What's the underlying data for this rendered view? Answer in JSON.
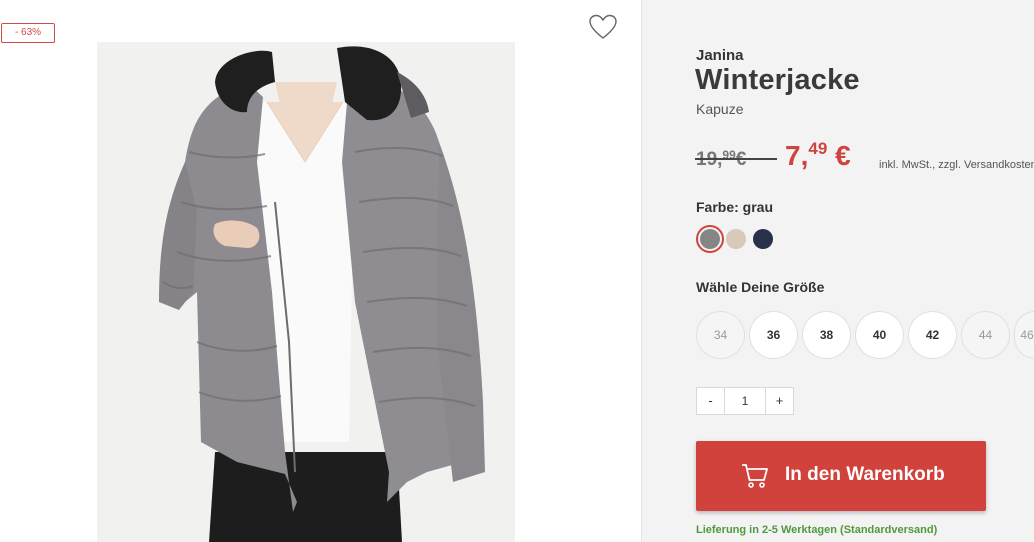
{
  "product": {
    "discount_badge": "- 63%",
    "brand": "Janina",
    "title": "Winterjacke",
    "subtitle": "Kapuze",
    "price_old_main": "19,",
    "price_old_cents": "99",
    "price_old_currency": "€",
    "price_new_main": "7,",
    "price_new_cents": "49",
    "price_new_currency": "€",
    "vat_note": "inkl. MwSt., zzgl. Versandkosten",
    "color_label": "Farbe: grau",
    "colors": [
      "#858585",
      "#d8c9b9",
      "#28304a"
    ],
    "size_label": "Wähle Deine Größe",
    "sizes": [
      {
        "label": "34",
        "available": false
      },
      {
        "label": "36",
        "available": true
      },
      {
        "label": "38",
        "available": true
      },
      {
        "label": "40",
        "available": true
      },
      {
        "label": "42",
        "available": true
      },
      {
        "label": "44",
        "available": false
      },
      {
        "label": "46",
        "available": false
      }
    ],
    "qty_minus": "-",
    "qty_value": "1",
    "qty_plus": "+",
    "cart_button": "In den Warenkorb",
    "delivery_note": "Lieferung in 2-5 Werktagen (Standardversand)"
  },
  "icons": {
    "wishlist": "heart-icon",
    "cart": "shopping-cart-icon"
  },
  "theme": {
    "accent": "#d2423d",
    "delivery": "#4f9a3b"
  }
}
